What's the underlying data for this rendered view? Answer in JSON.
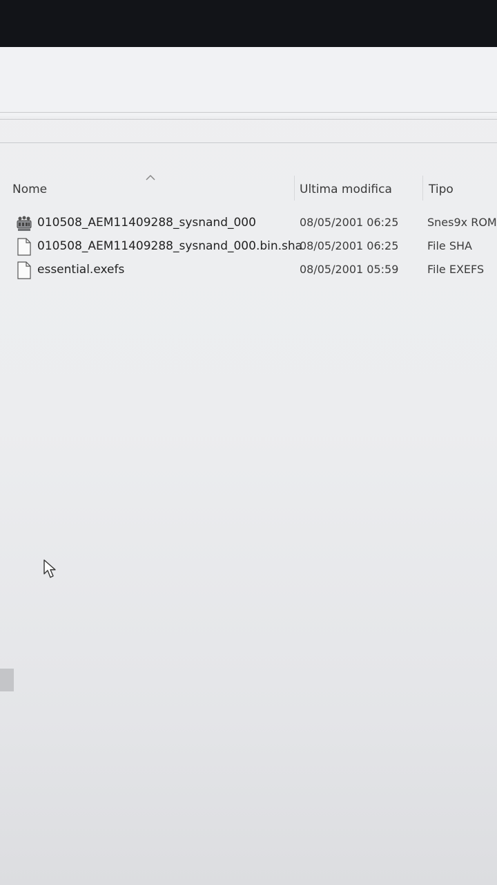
{
  "columns": {
    "name": "Nome",
    "modified": "Ultima modifica",
    "type": "Tipo"
  },
  "sort": {
    "column": "Nome",
    "indicator": "sort-up-icon"
  },
  "files": [
    {
      "name": "010508_AEM11409288_sysnand_000",
      "modified": "08/05/2001 06:25",
      "type": "Snes9x ROM",
      "icon": "snes9x-rom-icon"
    },
    {
      "name": "010508_AEM11409288_sysnand_000.bin.sha",
      "modified": "08/05/2001 06:25",
      "type": "File SHA",
      "icon": "file-icon"
    },
    {
      "name": "essential.exefs",
      "modified": "08/05/2001 05:59",
      "type": "File EXEFS",
      "icon": "file-icon"
    }
  ],
  "colors": {
    "text": "#222222",
    "background": "#eeeff1",
    "bezel": "#121418"
  }
}
